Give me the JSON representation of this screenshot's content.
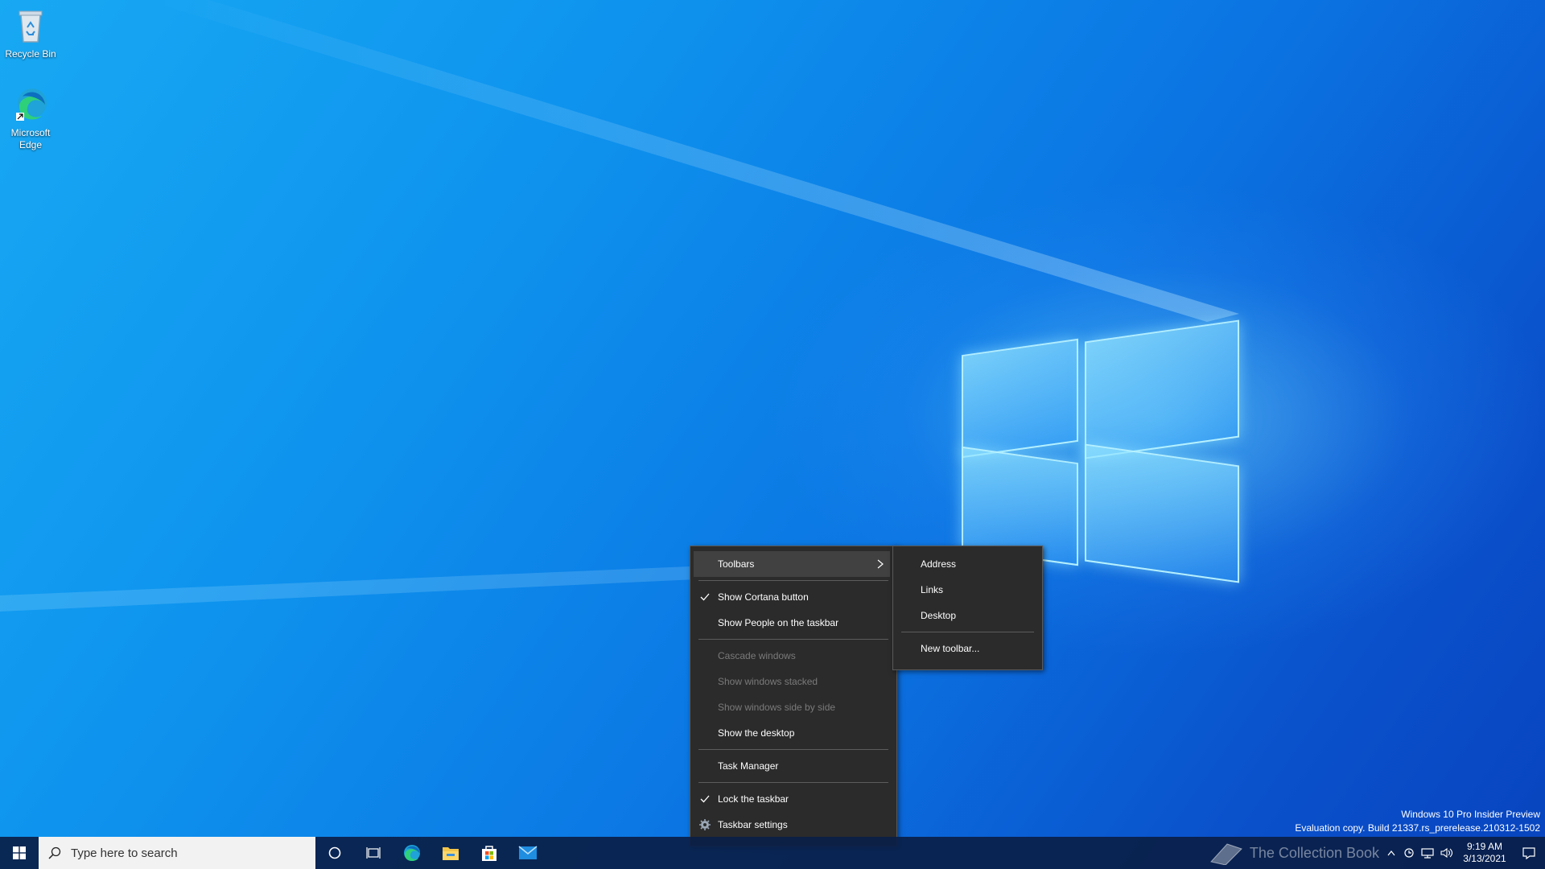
{
  "desktop": {
    "icons": [
      {
        "label": "Recycle Bin"
      },
      {
        "label": "Microsoft Edge"
      }
    ]
  },
  "context_menu": {
    "items": [
      {
        "label": "Toolbars",
        "has_submenu": true,
        "highlighted": true
      },
      {
        "label": "Show Cortana button",
        "checked": true
      },
      {
        "label": "Show People on the taskbar"
      },
      {
        "label": "Cascade windows",
        "disabled": true
      },
      {
        "label": "Show windows stacked",
        "disabled": true
      },
      {
        "label": "Show windows side by side",
        "disabled": true
      },
      {
        "label": "Show the desktop"
      },
      {
        "label": "Task Manager"
      },
      {
        "label": "Lock the taskbar",
        "checked": true
      },
      {
        "label": "Taskbar settings",
        "icon": "gear-icon"
      }
    ]
  },
  "toolbars_submenu": {
    "items": [
      {
        "label": "Address"
      },
      {
        "label": "Links"
      },
      {
        "label": "Desktop"
      },
      {
        "label": "New toolbar..."
      }
    ]
  },
  "taskbar": {
    "search_placeholder": "Type here to search",
    "pinned": [
      "cortana-icon",
      "task-view-icon",
      "edge-icon",
      "file-explorer-icon",
      "store-icon",
      "mail-icon"
    ],
    "clock": {
      "time": "9:19 AM",
      "date": "3/13/2021"
    }
  },
  "watermark": {
    "line1": "Windows 10 Pro Insider Preview",
    "line2": "Evaluation copy. Build 21337.rs_prerelease.210312-1502"
  },
  "overlay_brand": "The Collection Book",
  "colors": {
    "menu_bg": "#2b2b2b",
    "taskbar_bg": "#0a1e46",
    "accent": "#0078d7"
  }
}
